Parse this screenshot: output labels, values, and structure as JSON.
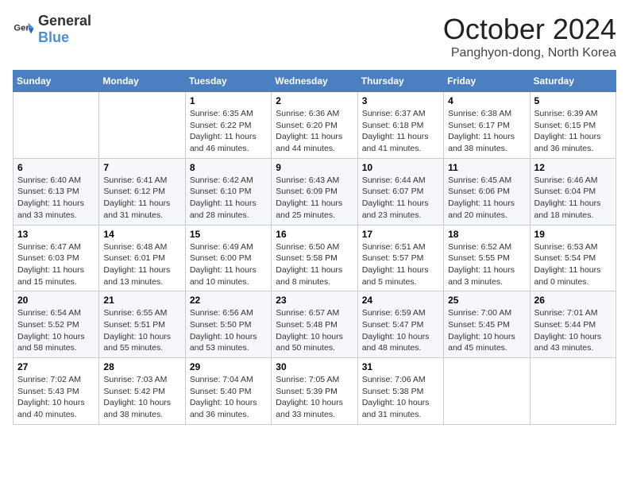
{
  "header": {
    "logo_general": "General",
    "logo_blue": "Blue",
    "month_title": "October 2024",
    "location": "Panghyon-dong, North Korea"
  },
  "weekdays": [
    "Sunday",
    "Monday",
    "Tuesday",
    "Wednesday",
    "Thursday",
    "Friday",
    "Saturday"
  ],
  "weeks": [
    [
      {
        "day": "",
        "sunrise": "",
        "sunset": "",
        "daylight": ""
      },
      {
        "day": "",
        "sunrise": "",
        "sunset": "",
        "daylight": ""
      },
      {
        "day": "1",
        "sunrise": "Sunrise: 6:35 AM",
        "sunset": "Sunset: 6:22 PM",
        "daylight": "Daylight: 11 hours and 46 minutes."
      },
      {
        "day": "2",
        "sunrise": "Sunrise: 6:36 AM",
        "sunset": "Sunset: 6:20 PM",
        "daylight": "Daylight: 11 hours and 44 minutes."
      },
      {
        "day": "3",
        "sunrise": "Sunrise: 6:37 AM",
        "sunset": "Sunset: 6:18 PM",
        "daylight": "Daylight: 11 hours and 41 minutes."
      },
      {
        "day": "4",
        "sunrise": "Sunrise: 6:38 AM",
        "sunset": "Sunset: 6:17 PM",
        "daylight": "Daylight: 11 hours and 38 minutes."
      },
      {
        "day": "5",
        "sunrise": "Sunrise: 6:39 AM",
        "sunset": "Sunset: 6:15 PM",
        "daylight": "Daylight: 11 hours and 36 minutes."
      }
    ],
    [
      {
        "day": "6",
        "sunrise": "Sunrise: 6:40 AM",
        "sunset": "Sunset: 6:13 PM",
        "daylight": "Daylight: 11 hours and 33 minutes."
      },
      {
        "day": "7",
        "sunrise": "Sunrise: 6:41 AM",
        "sunset": "Sunset: 6:12 PM",
        "daylight": "Daylight: 11 hours and 31 minutes."
      },
      {
        "day": "8",
        "sunrise": "Sunrise: 6:42 AM",
        "sunset": "Sunset: 6:10 PM",
        "daylight": "Daylight: 11 hours and 28 minutes."
      },
      {
        "day": "9",
        "sunrise": "Sunrise: 6:43 AM",
        "sunset": "Sunset: 6:09 PM",
        "daylight": "Daylight: 11 hours and 25 minutes."
      },
      {
        "day": "10",
        "sunrise": "Sunrise: 6:44 AM",
        "sunset": "Sunset: 6:07 PM",
        "daylight": "Daylight: 11 hours and 23 minutes."
      },
      {
        "day": "11",
        "sunrise": "Sunrise: 6:45 AM",
        "sunset": "Sunset: 6:06 PM",
        "daylight": "Daylight: 11 hours and 20 minutes."
      },
      {
        "day": "12",
        "sunrise": "Sunrise: 6:46 AM",
        "sunset": "Sunset: 6:04 PM",
        "daylight": "Daylight: 11 hours and 18 minutes."
      }
    ],
    [
      {
        "day": "13",
        "sunrise": "Sunrise: 6:47 AM",
        "sunset": "Sunset: 6:03 PM",
        "daylight": "Daylight: 11 hours and 15 minutes."
      },
      {
        "day": "14",
        "sunrise": "Sunrise: 6:48 AM",
        "sunset": "Sunset: 6:01 PM",
        "daylight": "Daylight: 11 hours and 13 minutes."
      },
      {
        "day": "15",
        "sunrise": "Sunrise: 6:49 AM",
        "sunset": "Sunset: 6:00 PM",
        "daylight": "Daylight: 11 hours and 10 minutes."
      },
      {
        "day": "16",
        "sunrise": "Sunrise: 6:50 AM",
        "sunset": "Sunset: 5:58 PM",
        "daylight": "Daylight: 11 hours and 8 minutes."
      },
      {
        "day": "17",
        "sunrise": "Sunrise: 6:51 AM",
        "sunset": "Sunset: 5:57 PM",
        "daylight": "Daylight: 11 hours and 5 minutes."
      },
      {
        "day": "18",
        "sunrise": "Sunrise: 6:52 AM",
        "sunset": "Sunset: 5:55 PM",
        "daylight": "Daylight: 11 hours and 3 minutes."
      },
      {
        "day": "19",
        "sunrise": "Sunrise: 6:53 AM",
        "sunset": "Sunset: 5:54 PM",
        "daylight": "Daylight: 11 hours and 0 minutes."
      }
    ],
    [
      {
        "day": "20",
        "sunrise": "Sunrise: 6:54 AM",
        "sunset": "Sunset: 5:52 PM",
        "daylight": "Daylight: 10 hours and 58 minutes."
      },
      {
        "day": "21",
        "sunrise": "Sunrise: 6:55 AM",
        "sunset": "Sunset: 5:51 PM",
        "daylight": "Daylight: 10 hours and 55 minutes."
      },
      {
        "day": "22",
        "sunrise": "Sunrise: 6:56 AM",
        "sunset": "Sunset: 5:50 PM",
        "daylight": "Daylight: 10 hours and 53 minutes."
      },
      {
        "day": "23",
        "sunrise": "Sunrise: 6:57 AM",
        "sunset": "Sunset: 5:48 PM",
        "daylight": "Daylight: 10 hours and 50 minutes."
      },
      {
        "day": "24",
        "sunrise": "Sunrise: 6:59 AM",
        "sunset": "Sunset: 5:47 PM",
        "daylight": "Daylight: 10 hours and 48 minutes."
      },
      {
        "day": "25",
        "sunrise": "Sunrise: 7:00 AM",
        "sunset": "Sunset: 5:45 PM",
        "daylight": "Daylight: 10 hours and 45 minutes."
      },
      {
        "day": "26",
        "sunrise": "Sunrise: 7:01 AM",
        "sunset": "Sunset: 5:44 PM",
        "daylight": "Daylight: 10 hours and 43 minutes."
      }
    ],
    [
      {
        "day": "27",
        "sunrise": "Sunrise: 7:02 AM",
        "sunset": "Sunset: 5:43 PM",
        "daylight": "Daylight: 10 hours and 40 minutes."
      },
      {
        "day": "28",
        "sunrise": "Sunrise: 7:03 AM",
        "sunset": "Sunset: 5:42 PM",
        "daylight": "Daylight: 10 hours and 38 minutes."
      },
      {
        "day": "29",
        "sunrise": "Sunrise: 7:04 AM",
        "sunset": "Sunset: 5:40 PM",
        "daylight": "Daylight: 10 hours and 36 minutes."
      },
      {
        "day": "30",
        "sunrise": "Sunrise: 7:05 AM",
        "sunset": "Sunset: 5:39 PM",
        "daylight": "Daylight: 10 hours and 33 minutes."
      },
      {
        "day": "31",
        "sunrise": "Sunrise: 7:06 AM",
        "sunset": "Sunset: 5:38 PM",
        "daylight": "Daylight: 10 hours and 31 minutes."
      },
      {
        "day": "",
        "sunrise": "",
        "sunset": "",
        "daylight": ""
      },
      {
        "day": "",
        "sunrise": "",
        "sunset": "",
        "daylight": ""
      }
    ]
  ]
}
